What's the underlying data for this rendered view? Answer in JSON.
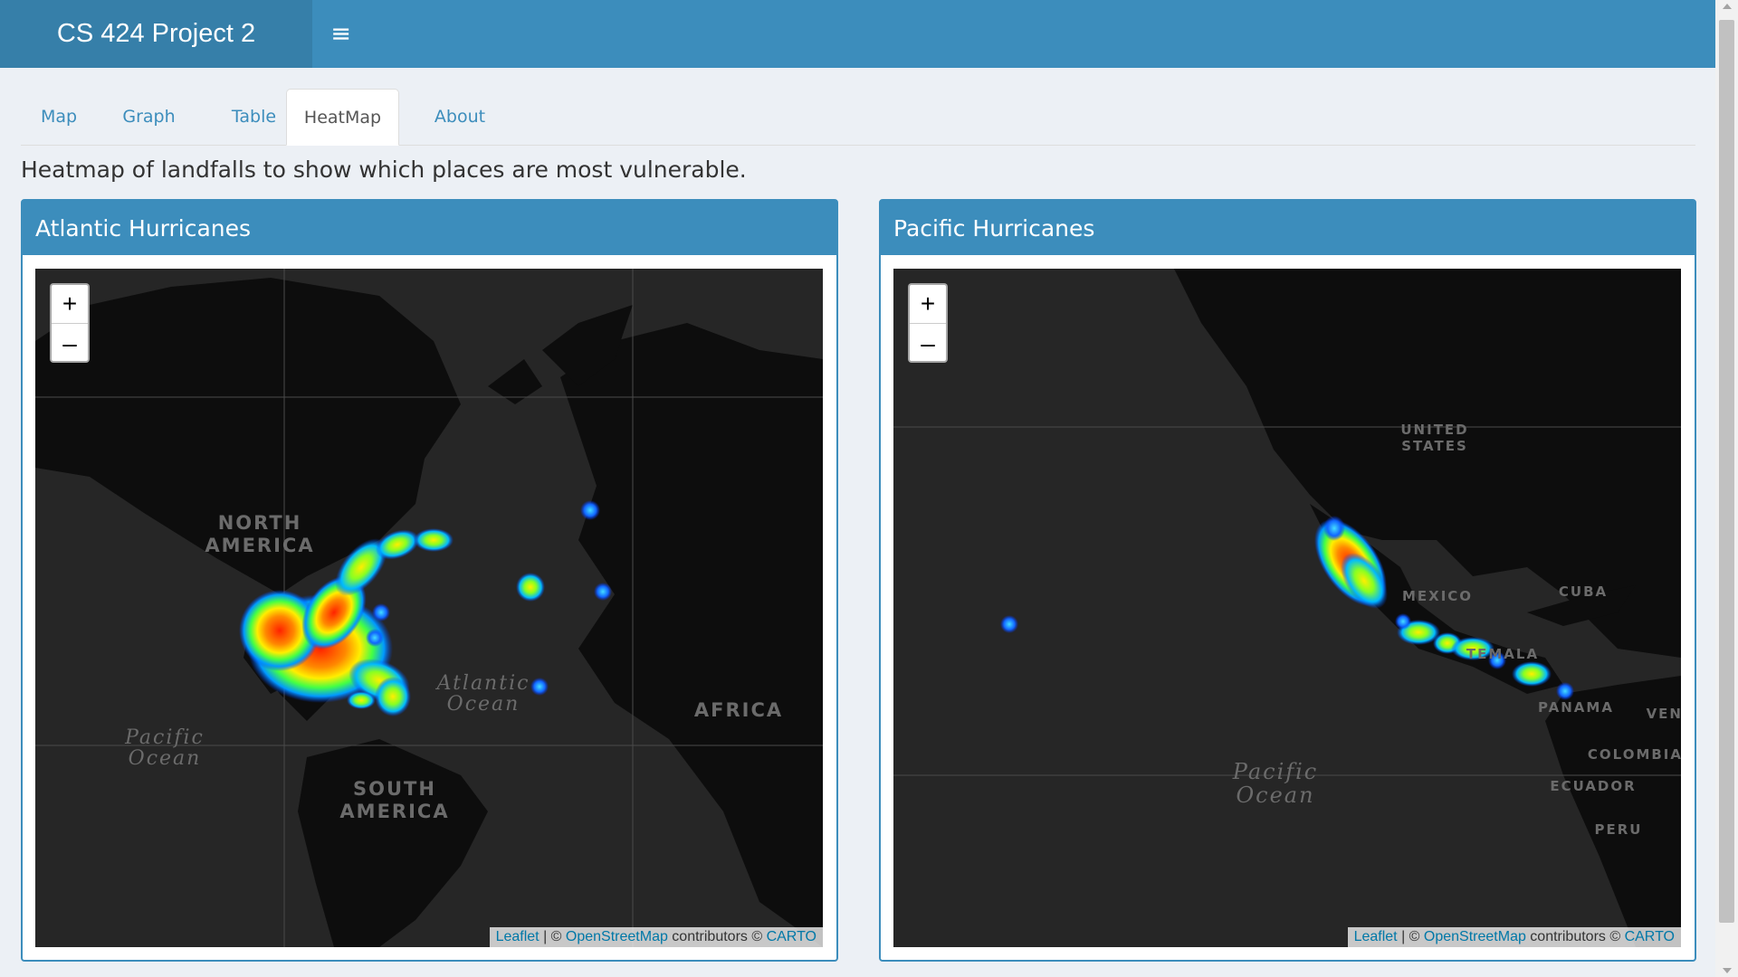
{
  "header": {
    "title": "CS 424 Project 2"
  },
  "tabs": [
    {
      "label": "Map"
    },
    {
      "label": "Graph"
    },
    {
      "label": "Table"
    },
    {
      "label": "HeatMap",
      "active": true
    },
    {
      "label": "About"
    }
  ],
  "description": "Heatmap of landfalls to show which places are most vulnerable.",
  "colors": {
    "header": "#3c8dbc",
    "logo_bg": "#367fa9",
    "page_bg": "#ecf0f5",
    "map_bg": "#262626"
  },
  "atlantic": {
    "title": "Atlantic Hurricanes",
    "labels": {
      "north_america_1": "NORTH",
      "north_america_2": "AMERICA",
      "south_america_1": "SOUTH",
      "south_america_2": "AMERICA",
      "africa": "AFRICA",
      "atlantic_1": "Atlantic",
      "atlantic_2": "Ocean",
      "pacific_1": "Pacific",
      "pacific_2": "Ocean"
    }
  },
  "pacific": {
    "title": "Pacific Hurricanes",
    "labels": {
      "us_1": "UNITED",
      "us_2": "STATES",
      "mexico": "MEXICO",
      "cuba": "CUBA",
      "guatemala": "TEMALA",
      "panama": "PANAMA",
      "colombia": "COLOMBIA",
      "ecuador": "ECUADOR",
      "peru": "PERU",
      "ven": "VEN",
      "pacific_1": "Pacific",
      "pacific_2": "Ocean"
    }
  },
  "map_controls": {
    "zoom_in": "+",
    "zoom_out": "–"
  },
  "attribution": {
    "leaflet": "Leaflet",
    "sep": " | © ",
    "osm": "OpenStreetMap",
    "contrib": " contributors © ",
    "carto": "CARTO"
  }
}
